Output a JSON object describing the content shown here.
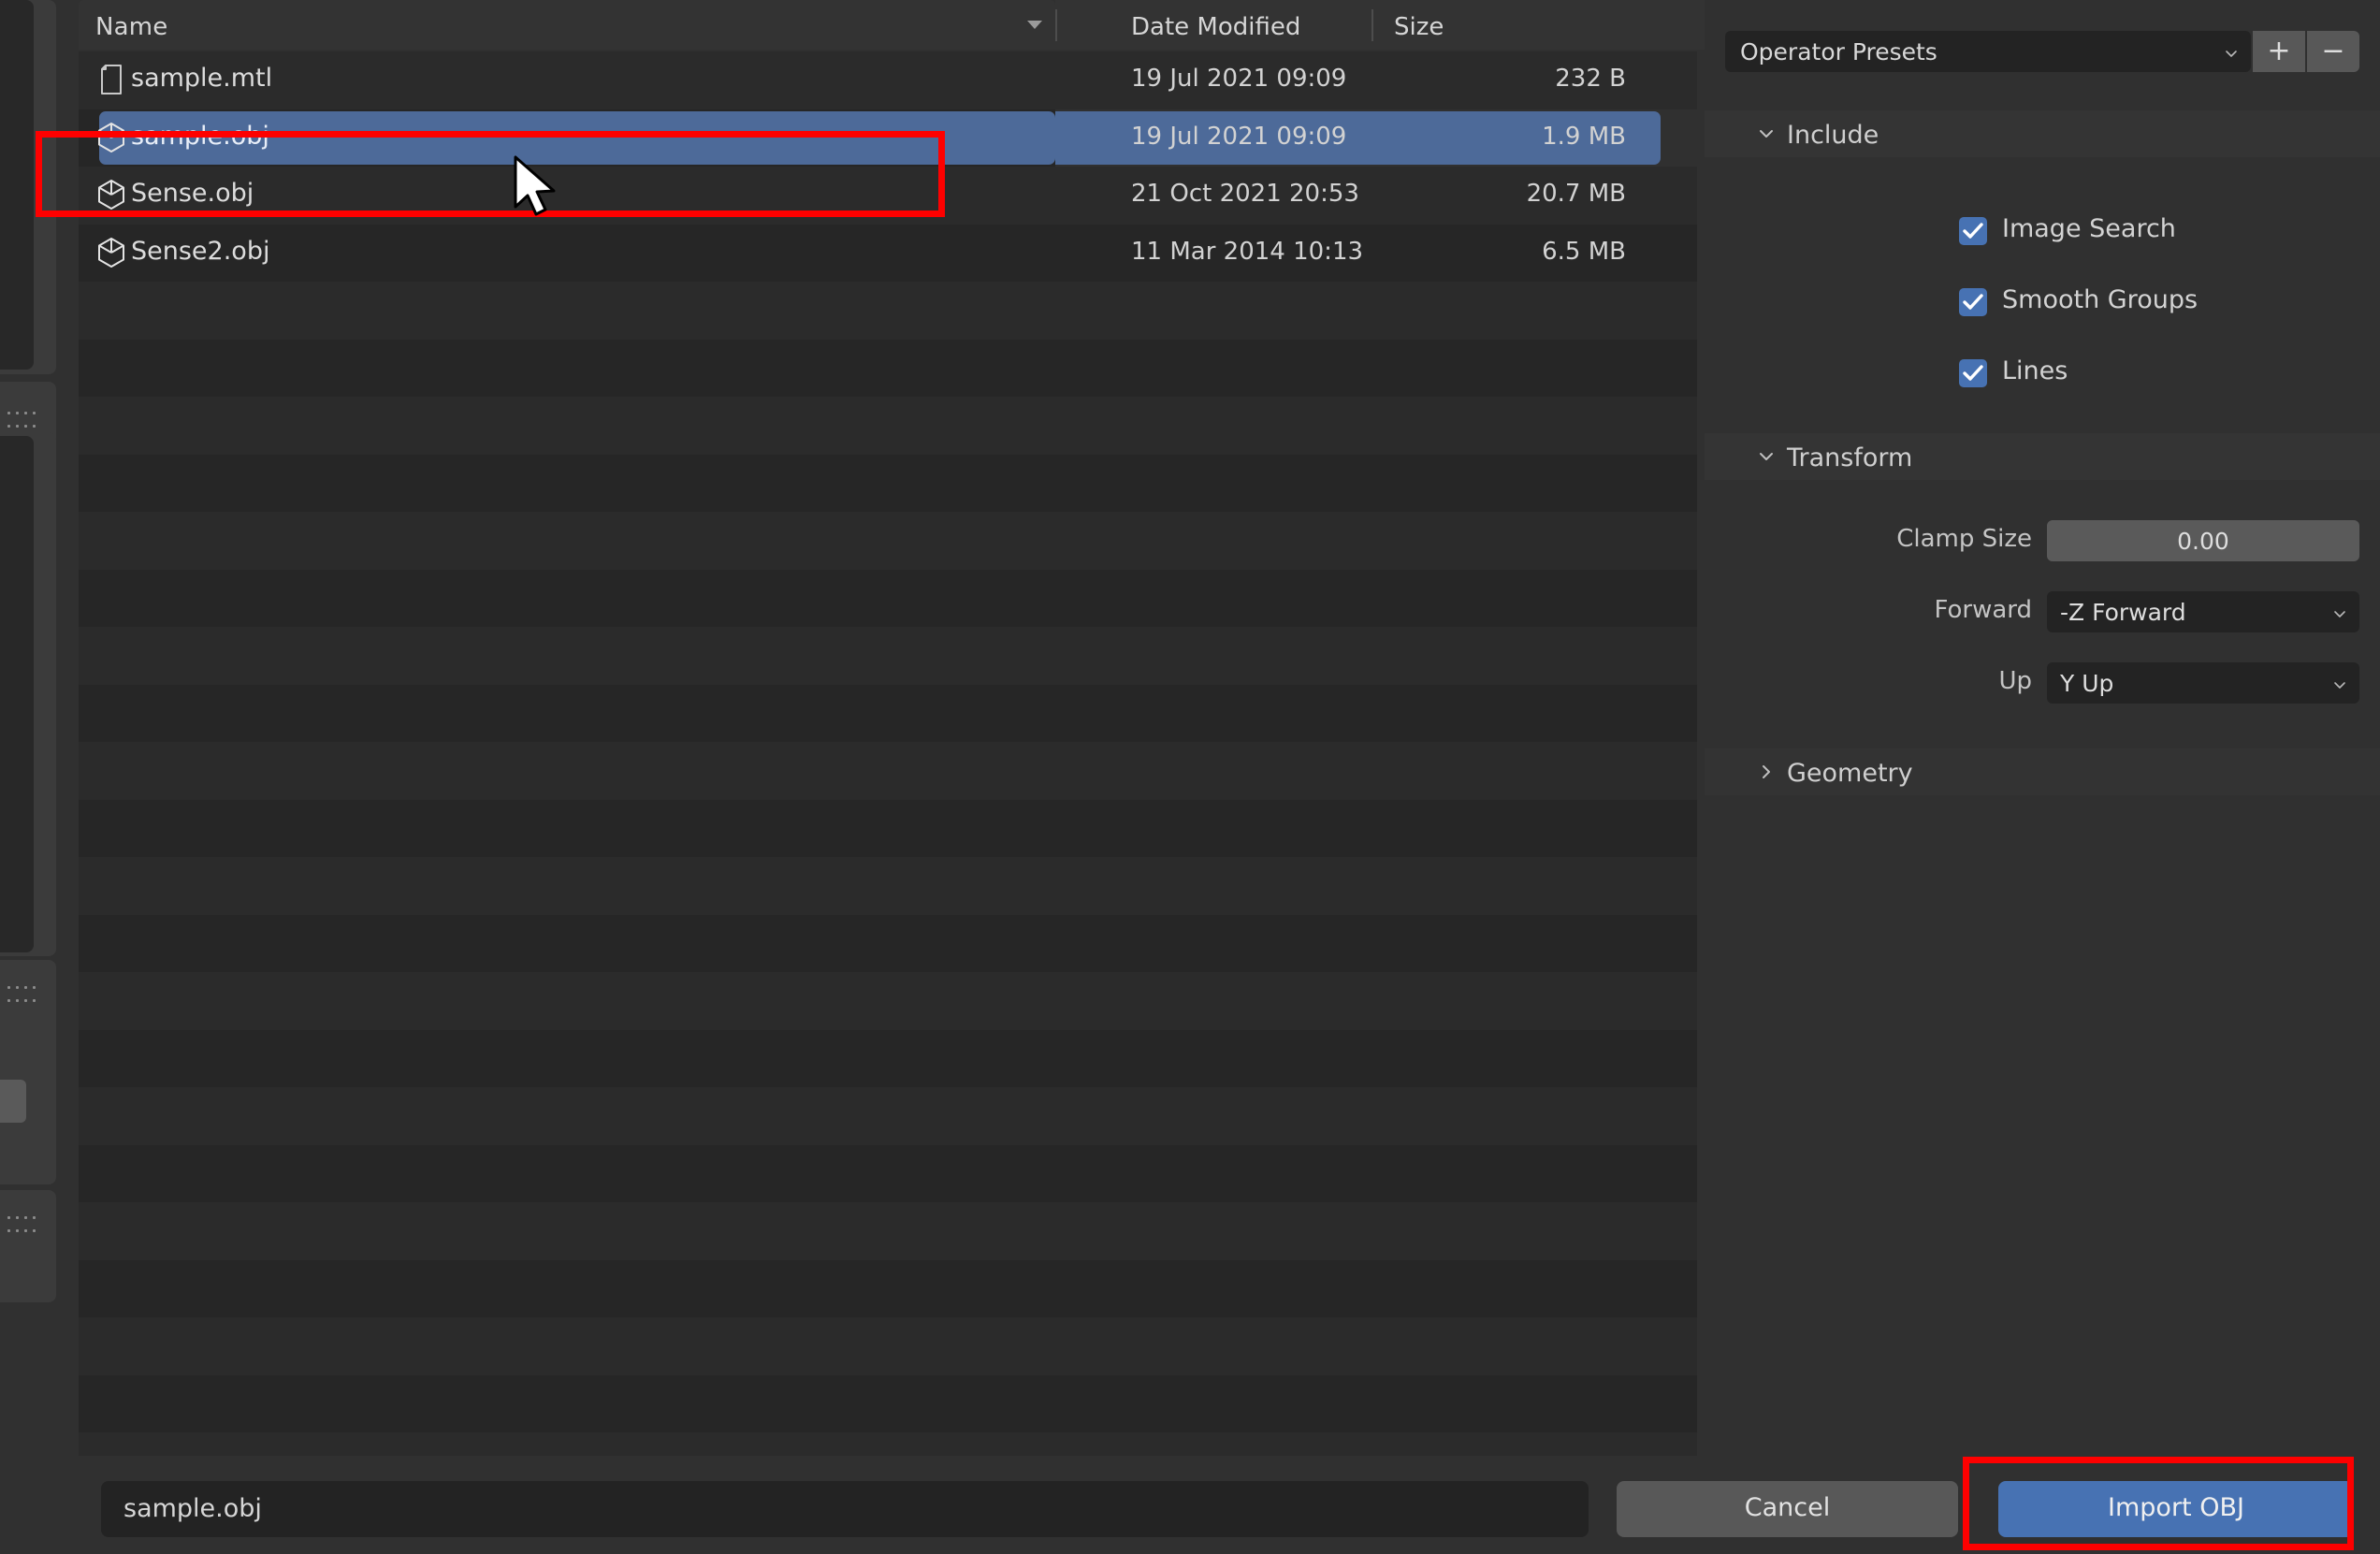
{
  "file_browser": {
    "columns": {
      "name": "Name",
      "date_modified": "Date Modified",
      "size": "Size",
      "sort_icon": "sort-descending-caret"
    },
    "rows": [
      {
        "name": "sample.mtl",
        "icon": "document-icon",
        "date": "19 Jul 2021 09:09",
        "size": "232 B",
        "selected": false
      },
      {
        "name": "sample.obj",
        "icon": "mesh-cube-icon",
        "date": "19 Jul 2021 09:09",
        "size": "1.9 MB",
        "selected": true
      },
      {
        "name": "Sense.obj",
        "icon": "mesh-cube-icon",
        "date": "21 Oct 2021 20:53",
        "size": "20.7 MB",
        "selected": false
      },
      {
        "name": "Sense2.obj",
        "icon": "mesh-cube-icon",
        "date": "11 Mar 2014 10:13",
        "size": "6.5 MB",
        "selected": false
      }
    ]
  },
  "operator_panel": {
    "preset": {
      "value": "Operator Presets",
      "dropdown_icon": "chevron-down-icon",
      "add_label": "+",
      "remove_label": "−"
    },
    "sections": [
      {
        "title": "Include",
        "expanded": true,
        "chevron": "chevron-down-icon",
        "checkboxes": [
          {
            "label": "Image Search",
            "checked": true
          },
          {
            "label": "Smooth Groups",
            "checked": true
          },
          {
            "label": "Lines",
            "checked": true
          }
        ]
      },
      {
        "title": "Transform",
        "expanded": true,
        "chevron": "chevron-down-icon",
        "properties": [
          {
            "label": "Clamp Size",
            "value": "0.00",
            "type": "numeric"
          },
          {
            "label": "Forward",
            "value": "-Z Forward",
            "type": "dropdown"
          },
          {
            "label": "Up",
            "value": "Y Up",
            "type": "dropdown"
          }
        ]
      },
      {
        "title": "Geometry",
        "expanded": false,
        "chevron": "chevron-right-icon"
      }
    ]
  },
  "footer": {
    "filename_value": "sample.obj",
    "filename_placeholder": "sample.obj",
    "cancel_label": "Cancel",
    "import_label": "Import OBJ"
  },
  "colors": {
    "accent_blue": "#4772b3",
    "selection_blue": "#4d6a99",
    "annotation_red": "#fe0000",
    "panel_bg": "#303030",
    "list_bg": "#2a2a2a",
    "header_bg": "#333333",
    "field_bg": "#232323"
  },
  "annotations": [
    {
      "name": "selected-file-row-highlight"
    },
    {
      "name": "import-button-highlight"
    }
  ]
}
